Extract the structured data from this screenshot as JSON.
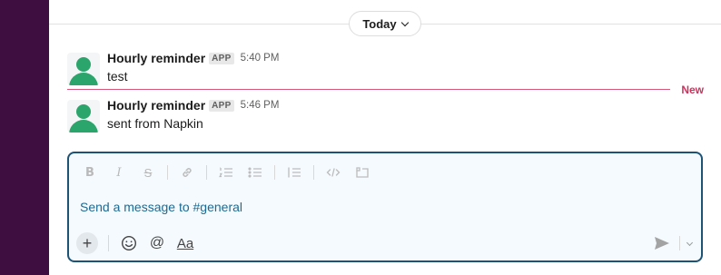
{
  "colors": {
    "sidebar": "#3f0e40",
    "new_marker": "#d12f5c",
    "composer_border": "#1d5375",
    "avatar": "#2ba56b",
    "placeholder": "#1d6a94"
  },
  "date_divider": {
    "label": "Today",
    "icon": "chevron-down-icon"
  },
  "messages": [
    {
      "sender": "Hourly reminder",
      "badge": "APP",
      "time": "5:40 PM",
      "text": "test"
    },
    {
      "sender": "Hourly reminder",
      "badge": "APP",
      "time": "5:46 PM",
      "text": "sent from Napkin"
    }
  ],
  "new_divider": {
    "label": "New"
  },
  "composer": {
    "placeholder": "Send a message to #general",
    "toolbar": {
      "bold": "B",
      "italic": "I",
      "strike": "S",
      "link": "link-icon",
      "ordered_list": "ordered-list-icon",
      "bulleted_list": "bulleted-list-icon",
      "blockquote": "blockquote-icon",
      "code": "code-icon",
      "code_block": "code-block-icon"
    },
    "bottom": {
      "plus": "+",
      "emoji": "emoji-icon",
      "mention": "@",
      "formatting": "Aa",
      "send": "send-icon"
    }
  }
}
